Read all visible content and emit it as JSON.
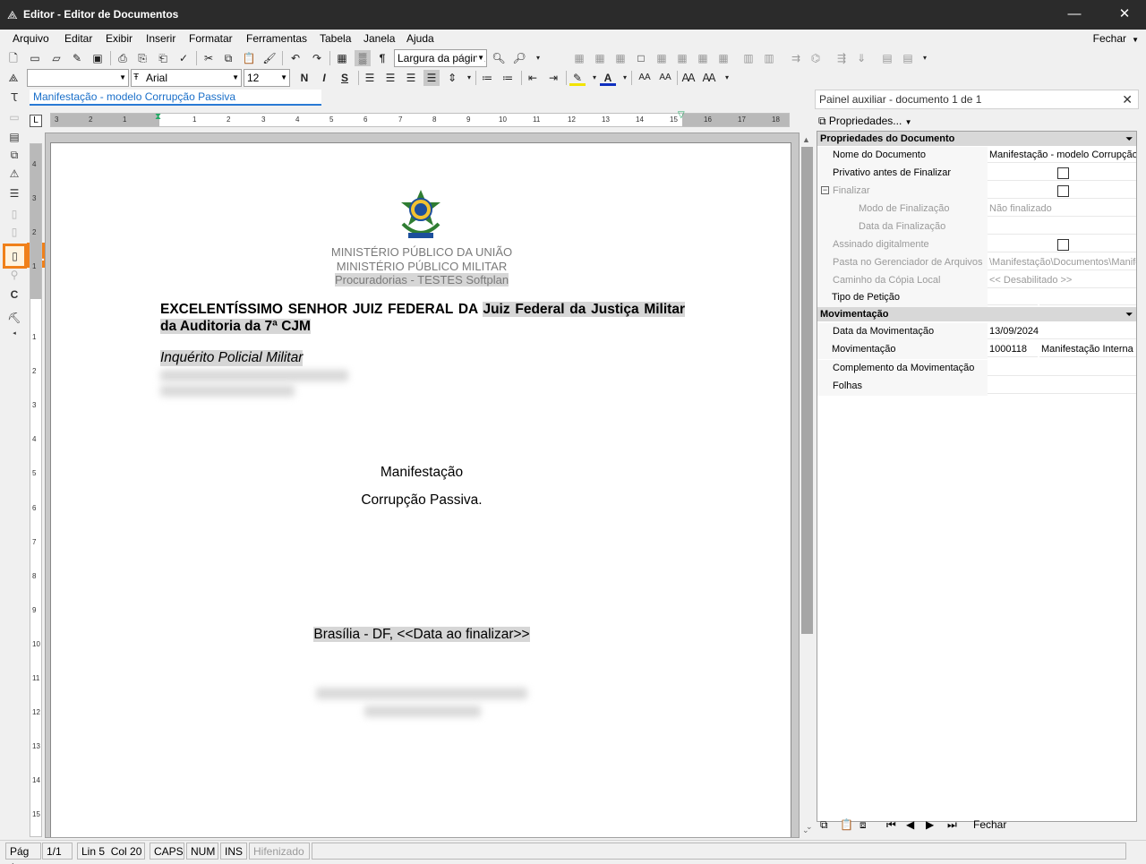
{
  "window": {
    "title": "Editor - Editor de Documentos",
    "minimize_glyph": "—",
    "close_glyph": "✕"
  },
  "menu": {
    "items": [
      "Arquivo",
      "Editar",
      "Exibir",
      "Inserir",
      "Formatar",
      "Ferramentas",
      "Tabela",
      "Janela",
      "Ajuda"
    ],
    "close": "Fechar"
  },
  "toolbar": {
    "zoom_value": "Largura da página",
    "style_value": "",
    "font_value": "Arial",
    "size_value": "12",
    "bold": "N",
    "italic": "I",
    "underline": "S",
    "pilcrow": "¶"
  },
  "tab": {
    "label": "Manifestação - modelo Corrupção Passiva"
  },
  "left_toolbar": {
    "active_badge": "1",
    "c_label": "C"
  },
  "ruler": {
    "h_ticks": [
      "3",
      "2",
      "1",
      "1",
      "2",
      "3",
      "4",
      "5",
      "6",
      "7",
      "8",
      "9",
      "10",
      "11",
      "12",
      "13",
      "14",
      "15",
      "16",
      "17",
      "18"
    ],
    "v_ticks": [
      "4",
      "3",
      "2",
      "1",
      "1",
      "2",
      "3",
      "4",
      "5",
      "6",
      "7",
      "8",
      "9",
      "10",
      "11",
      "12",
      "13",
      "14",
      "15"
    ]
  },
  "document": {
    "header_line1": "MINISTÉRIO PÚBLICO DA UNIÃO",
    "header_line2": "MINISTÉRIO PÚBLICO MILITAR",
    "header_line3": "Procuradorias - TESTES Softplan",
    "addressee_prefix": "EXCELENTÍSSIMO SENHOR JUIZ FEDERAL DA ",
    "addressee_highlight": "Juiz Federal da Justiça Militar da Auditoria da 7ª CJM",
    "inquiry": "Inquérito Policial Militar",
    "title": "Manifestação",
    "subject": "Corrupção Passiva.",
    "city": "Brasília - DF, ",
    "date_field": "<<Data ao finalizar>>"
  },
  "panel": {
    "title": "Painel auxiliar - documento 1 de 1",
    "properties_button": "Propriedades...",
    "section_document": "Propriedades do Documento",
    "section_movement": "Movimentação",
    "rows": {
      "nome_label": "Nome do Documento",
      "nome_value": "Manifestação - modelo Corrupção Passiva",
      "privativo_label": "Privativo antes de Finalizar",
      "finalizar_label": "Finalizar",
      "modo_label": "Modo de Finalização",
      "modo_value": "Não finalizado",
      "data_final_label": "Data da Finalização",
      "assinado_label": "Assinado digitalmente",
      "pasta_label": "Pasta no Gerenciador de Arquivos",
      "pasta_value": "\\Manifestação\\Documentos\\Manifestação",
      "caminho_label": "Caminho da Cópia Local",
      "caminho_value": "<< Desabilitado >>",
      "tipo_label": "Tipo de Petição",
      "data_mov_label": "Data da Movimentação",
      "data_mov_value": "13/09/2024",
      "mov_label": "Movimentação",
      "mov_code": "1000118",
      "mov_name": "Manifestação Interna",
      "compl_label": "Complemento da Movimentação",
      "folhas_label": "Folhas"
    },
    "footer_close": "Fechar"
  },
  "status": {
    "page": "Pág 1",
    "pages": "1/1",
    "position": "Lin 5  Col 20",
    "caps": "CAPS",
    "num": "NUM",
    "ins": "INS",
    "hyphen": "Hifenizado"
  }
}
